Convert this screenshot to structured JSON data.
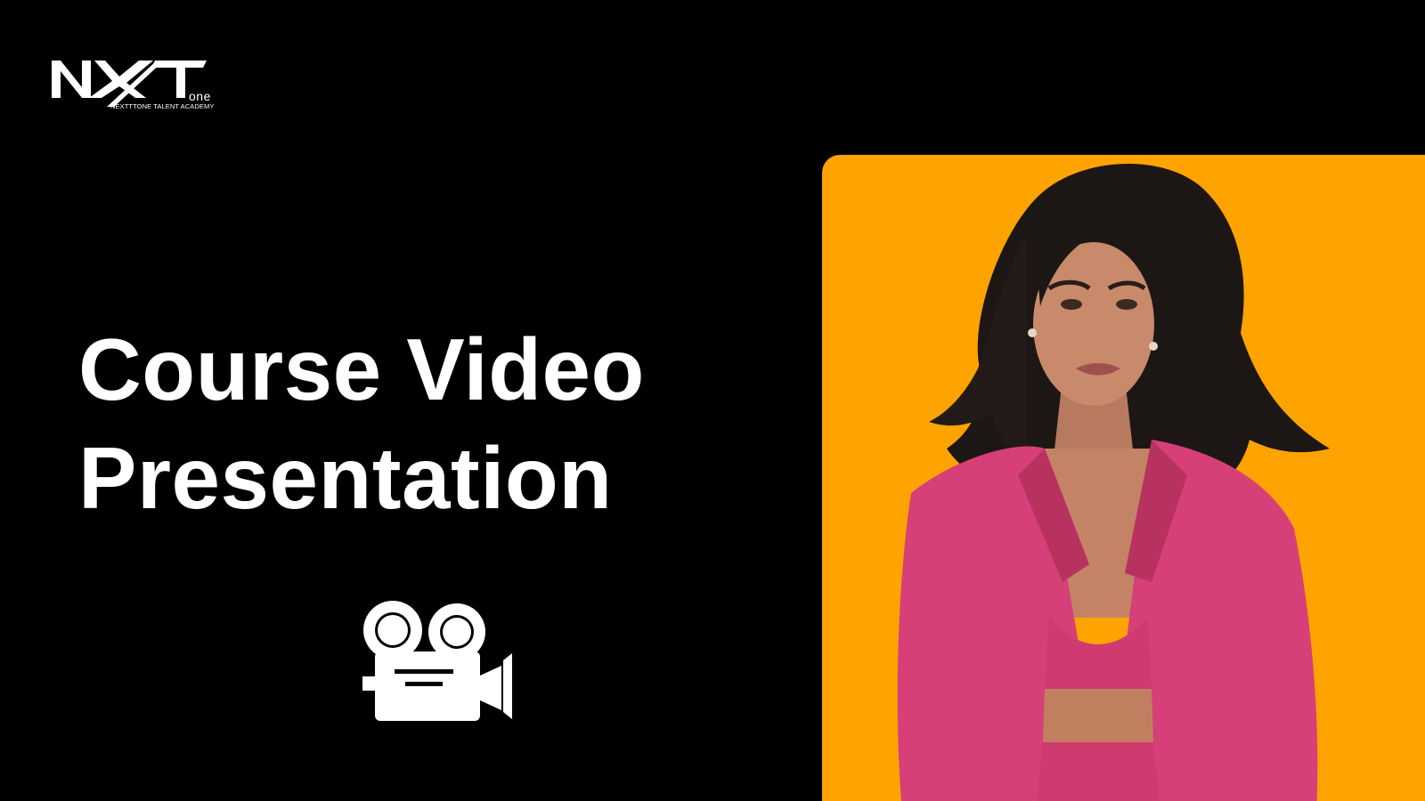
{
  "logo": {
    "mark": "NXT",
    "suffix": "one",
    "tagline": "NEXTTTONE TALENT ACADEMY"
  },
  "title": {
    "line1": "Course Video",
    "line2": "Presentation"
  },
  "icons": {
    "camera": "movie-camera-icon"
  },
  "colors": {
    "background": "#000000",
    "accent": "#ffa300",
    "text": "#ffffff",
    "jacket": "#d63f78"
  }
}
